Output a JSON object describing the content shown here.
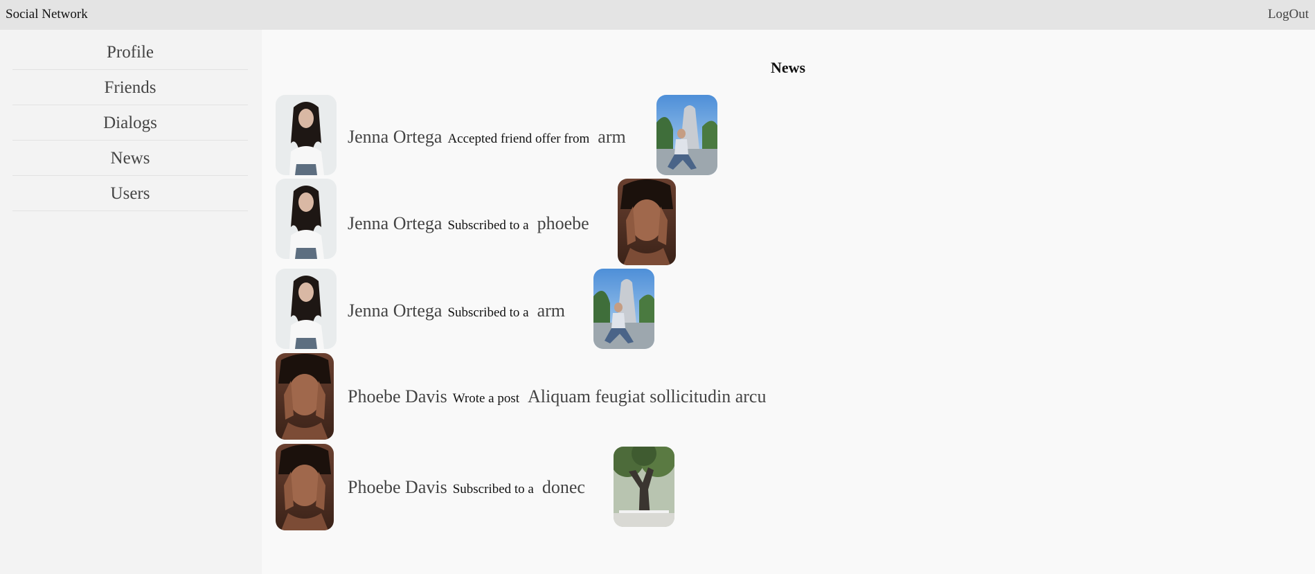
{
  "app": {
    "brand": "Social Network",
    "logout_label": "LogOut"
  },
  "sidebar": {
    "items": [
      {
        "label": "Profile"
      },
      {
        "label": "Friends"
      },
      {
        "label": "Dialogs"
      },
      {
        "label": "News"
      },
      {
        "label": "Users"
      }
    ]
  },
  "news": {
    "title": "News",
    "items": [
      {
        "name": "Jenna Ortega",
        "action": "Accepted friend offer from",
        "target": "arm",
        "avatar": "jenna-photo",
        "target_image": "arm-photo"
      },
      {
        "name": "Jenna Ortega",
        "action": "Subscribed to a",
        "target": "phoebe",
        "avatar": "jenna-photo",
        "target_image": "phoebe-photo"
      },
      {
        "name": "Jenna Ortega",
        "action": "Subscribed to a",
        "target": "arm",
        "avatar": "jenna-photo",
        "target_image": "arm-photo"
      },
      {
        "name": "Phoebe Davis",
        "action": "Wrote a post",
        "target": "Aliquam feugiat sollicitudin arcu",
        "avatar": "phoebe-photo",
        "target_image": ""
      },
      {
        "name": "Phoebe Davis",
        "action": "Subscribed to a",
        "target": "donec",
        "avatar": "phoebe-photo",
        "target_image": "tree-photo"
      }
    ]
  }
}
